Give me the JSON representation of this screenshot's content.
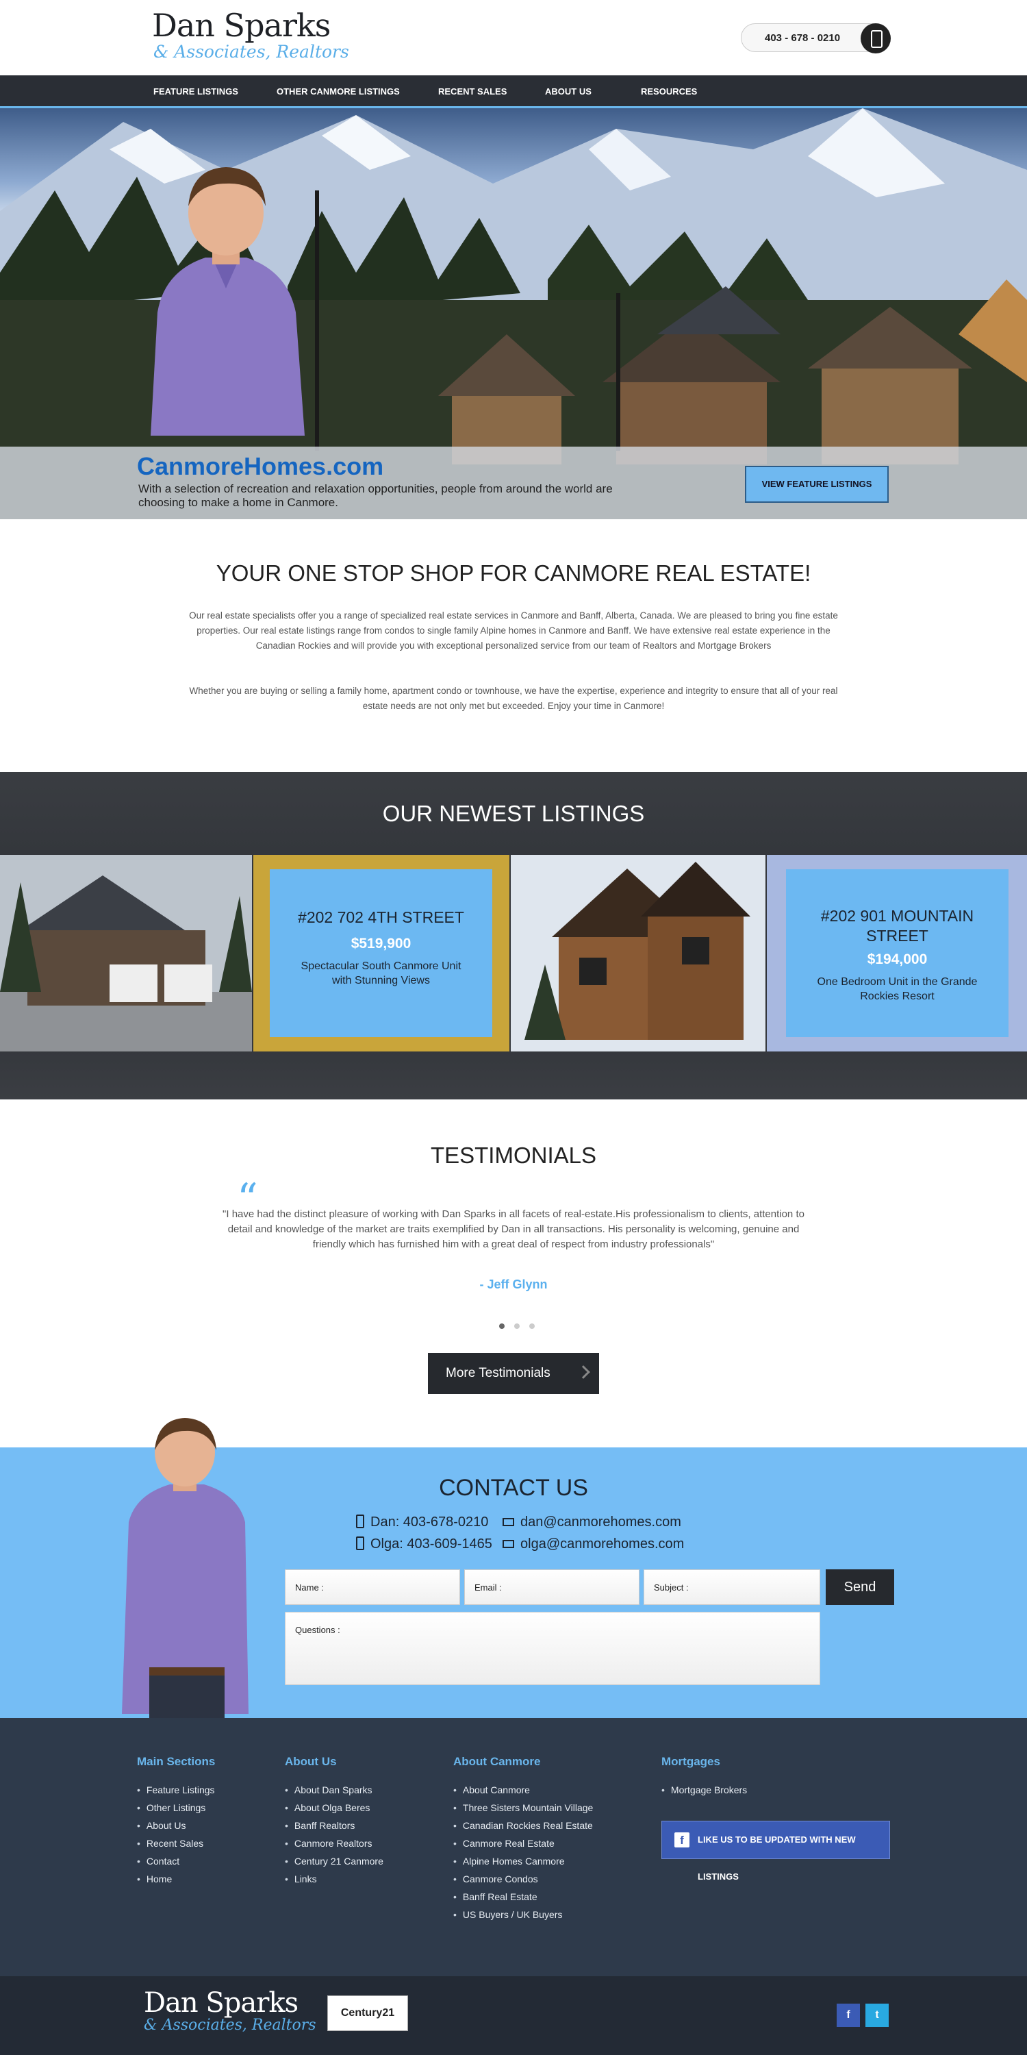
{
  "header": {
    "logo_name": "Dan Sparks",
    "logo_sub": "& Associates, Realtors",
    "phone": "403 - 678 - 0210"
  },
  "nav": {
    "items": [
      {
        "label": "FEATURE LISTINGS"
      },
      {
        "label": "OTHER CANMORE LISTINGS"
      },
      {
        "label": "RECENT SALES"
      },
      {
        "label": "ABOUT US"
      },
      {
        "label": "RESOURCES"
      }
    ]
  },
  "hero": {
    "title": "CanmoreHomes.com",
    "text": "With a selection of recreation and relaxation opportunities, people from around the world are choosing to make a home in Canmore.",
    "button": "VIEW FEATURE LISTINGS"
  },
  "intro": {
    "title": "YOUR ONE STOP SHOP FOR CANMORE REAL ESTATE!",
    "p1": "Our real estate specialists offer you a range of specialized real estate services in Canmore and Banff, Alberta, Canada.  We are pleased to bring you fine estate properties.  Our real estate listings range from condos to single family Alpine homes in Canmore and Banff.  We have extensive real estate experience in the Canadian Rockies and will provide you with exceptional personalized service from our team of Realtors and Mortgage Brokers",
    "p2": "Whether you are buying or selling a family home, apartment condo or townhouse, we have the expertise, experience and integrity to ensure that all of your real estate needs are not only met but exceeded.  Enjoy your time in Canmore!"
  },
  "listings": {
    "title": "OUR NEWEST LISTINGS",
    "cards": [
      {
        "address": "#202 702 4TH STREET",
        "price": "$519,900",
        "desc": "Spectacular South Canmore Unit with Stunning Views"
      },
      {
        "address": "#202 901 MOUNTAIN STREET",
        "price": "$194,000",
        "desc": "One Bedroom Unit in the Grande Rockies Resort"
      }
    ]
  },
  "testimonials": {
    "title": "TESTIMONIALS",
    "quote_mark": "“",
    "text": "\"I have had the distinct pleasure of working with Dan Sparks in all facets of real-estate.His professionalism to clients, attention to detail and knowledge of the market are traits exemplified by Dan in all transactions. His personality is welcoming, genuine and friendly which has furnished him with a great deal of respect from industry professionals\"",
    "author": "- Jeff Glynn",
    "more_button": "More Testimonials"
  },
  "contact": {
    "title": "CONTACT US",
    "dan_phone": "Dan: 403-678-0210",
    "dan_email": "dan@canmorehomes.com",
    "olga_phone": "Olga: 403-609-1465",
    "olga_email": "olga@canmorehomes.com",
    "name_placeholder": "Name :",
    "email_placeholder": "Email :",
    "subject_placeholder": "Subject :",
    "questions_placeholder": "Questions :",
    "send": "Send"
  },
  "footer": {
    "columns": [
      {
        "title": "Main Sections",
        "items": [
          "Feature Listings",
          "Other Listings",
          "About Us",
          "Recent Sales",
          "Contact",
          "Home"
        ]
      },
      {
        "title": "About Us",
        "items": [
          "About Dan Sparks",
          "About Olga Beres",
          "Banff Realtors",
          "Canmore Realtors",
          "Century 21 Canmore",
          "Links"
        ]
      },
      {
        "title": "About Canmore",
        "items": [
          "About Canmore",
          "Three Sisters Mountain Village",
          "Canadian Rockies Real Estate",
          "Canmore Real Estate",
          "Alpine Homes Canmore",
          "Canmore Condos",
          "Banff Real Estate",
          "US Buyers / UK Buyers"
        ]
      },
      {
        "title": "Mortgages",
        "items": [
          "Mortgage Brokers"
        ]
      }
    ],
    "facebook_button": "LIKE US TO BE UPDATED WITH NEW LISTINGS"
  },
  "bottom": {
    "logo_name": "Dan Sparks",
    "logo_sub": "& Associates, Realtors",
    "century21": "Century21"
  },
  "colors": {
    "accent_blue": "#6ab6ec",
    "dark": "#26292e",
    "footer": "#2e3a4b",
    "contact_bg": "#75bdf5"
  }
}
